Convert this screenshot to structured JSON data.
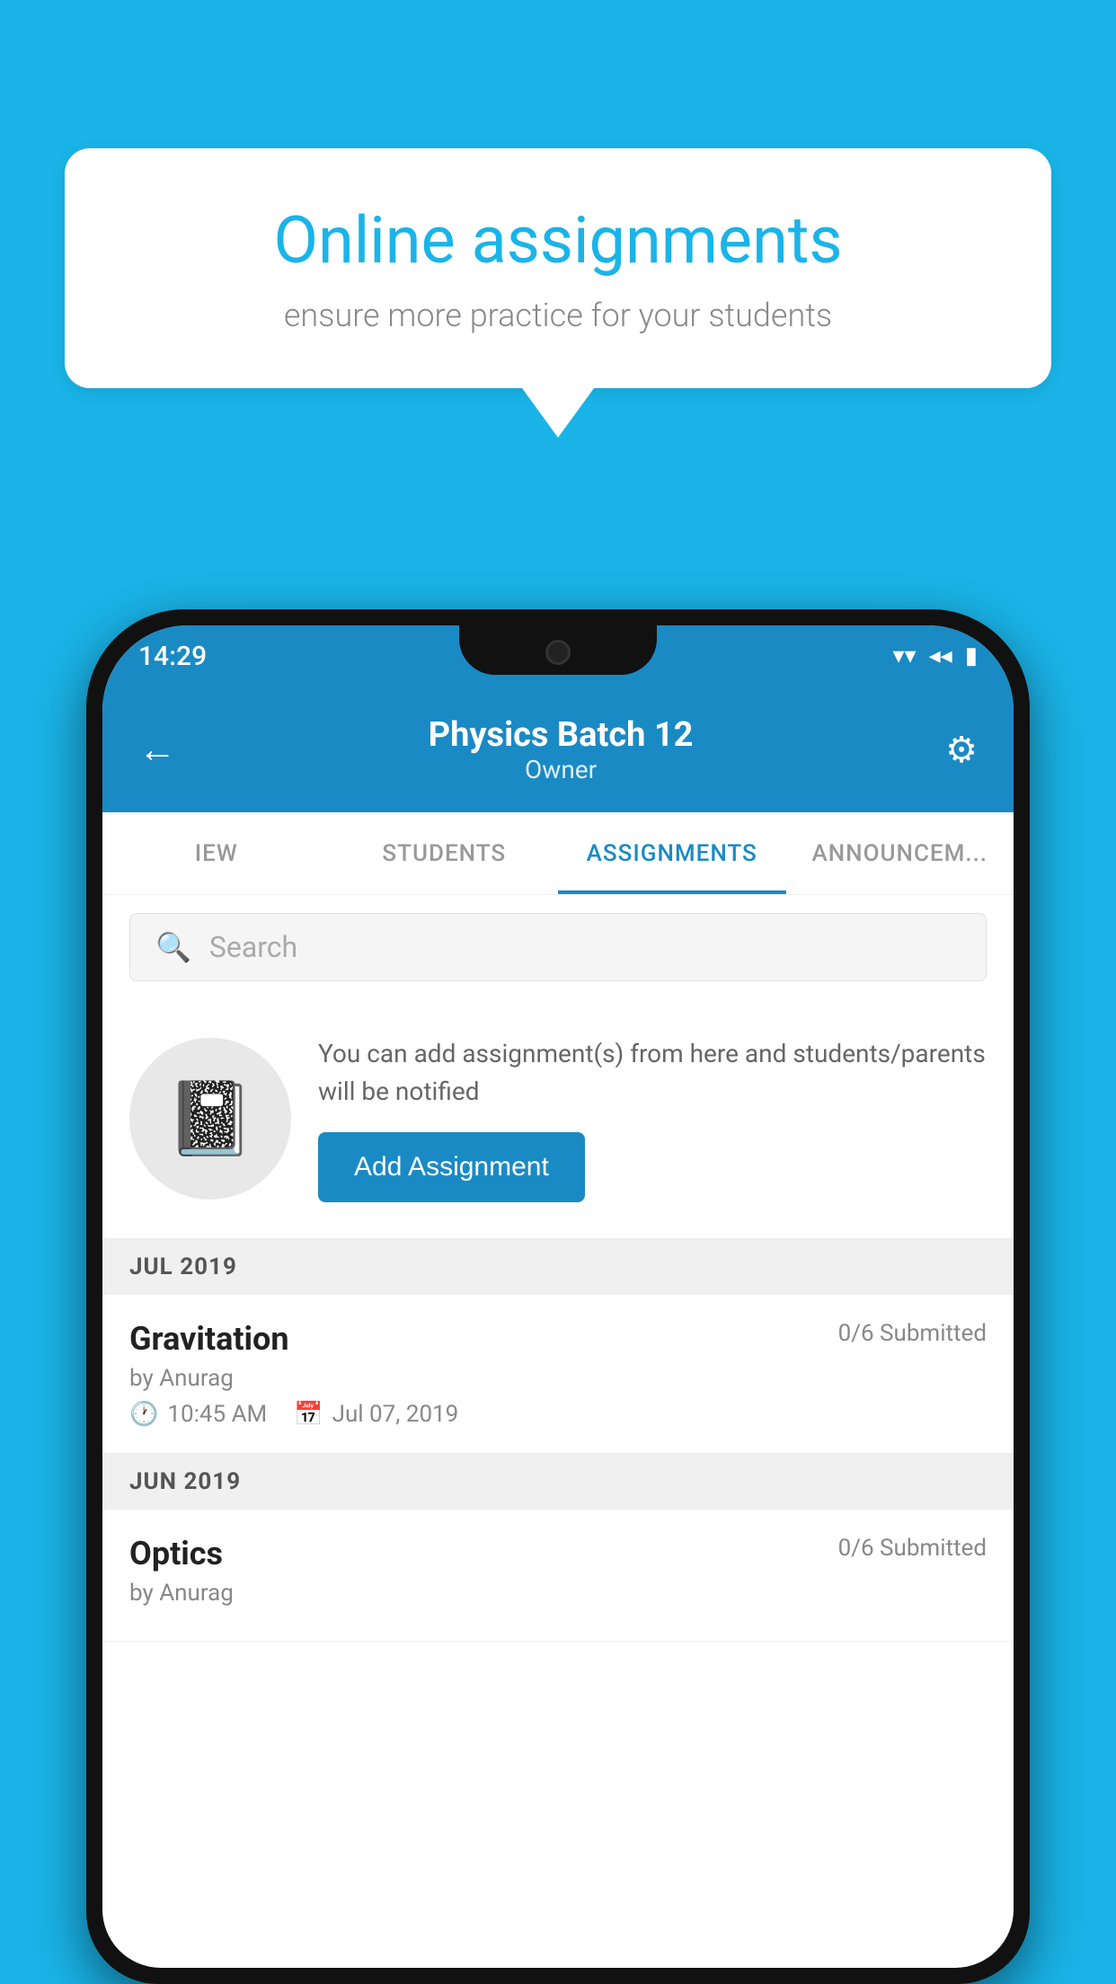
{
  "background_color": "#1ab4e8",
  "speech_bubble": {
    "title": "Online assignments",
    "subtitle": "ensure more practice for your students"
  },
  "phone": {
    "status_bar": {
      "time": "14:29",
      "wifi": "▾",
      "signal": "◂",
      "battery": "▮"
    },
    "app_bar": {
      "back_label": "←",
      "title": "Physics Batch 12",
      "subtitle": "Owner",
      "settings_label": "⚙"
    },
    "tabs": [
      {
        "id": "view",
        "label": "IEW",
        "active": false
      },
      {
        "id": "students",
        "label": "STUDENTS",
        "active": false
      },
      {
        "id": "assignments",
        "label": "ASSIGNMENTS",
        "active": true
      },
      {
        "id": "announcements",
        "label": "ANNOUNCEM...",
        "active": false
      }
    ],
    "search": {
      "placeholder": "Search"
    },
    "promo": {
      "text": "You can add assignment(s) from here and students/parents will be notified",
      "button_label": "Add Assignment"
    },
    "sections": [
      {
        "label": "JUL 2019",
        "assignments": [
          {
            "name": "Gravitation",
            "submitted": "0/6 Submitted",
            "author": "by Anurag",
            "time": "10:45 AM",
            "date": "Jul 07, 2019"
          }
        ]
      },
      {
        "label": "JUN 2019",
        "assignments": [
          {
            "name": "Optics",
            "submitted": "0/6 Submitted",
            "author": "by Anurag",
            "time": "",
            "date": ""
          }
        ]
      }
    ]
  }
}
